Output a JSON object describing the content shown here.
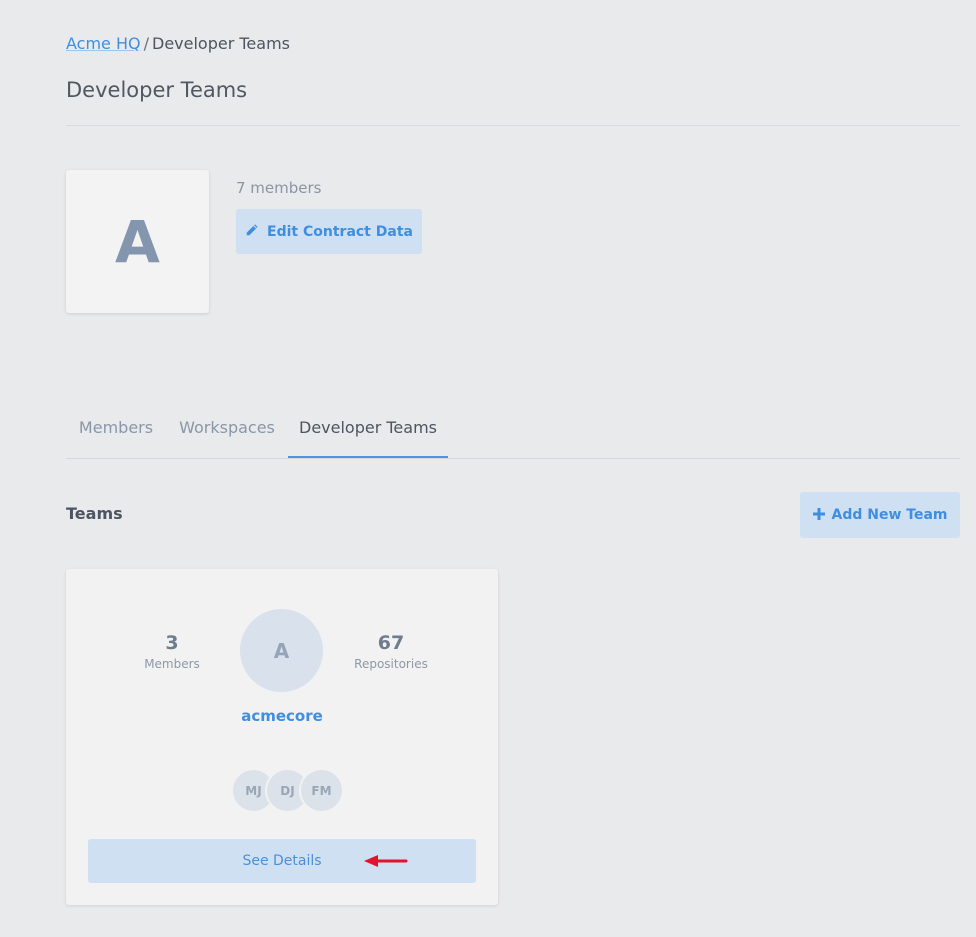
{
  "breadcrumb": {
    "root": "Acme HQ",
    "separator": "/",
    "current": "Developer Teams"
  },
  "page_title": "Developer Teams",
  "org": {
    "avatar_letter": "A",
    "member_count": "7 members",
    "edit_label": "Edit Contract Data"
  },
  "tabs": [
    {
      "label": "Members",
      "active": false
    },
    {
      "label": "Workspaces",
      "active": false
    },
    {
      "label": "Developer Teams",
      "active": true
    }
  ],
  "teams_section": {
    "title": "Teams",
    "add_label": "Add New Team"
  },
  "team_card": {
    "avatar_letter": "A",
    "name": "acmecore",
    "members_count": "3",
    "members_label": "Members",
    "repos_count": "67",
    "repos_label": "Repositories",
    "member_initials": [
      "MJ",
      "DJ",
      "FM"
    ],
    "details_label": "See Details"
  },
  "colors": {
    "accent": "#3f8ee0",
    "button_bg": "#cfe0f2",
    "annotation_arrow": "#e0142c"
  },
  "icons": {
    "edit": "pencil-icon",
    "add": "plus-icon",
    "annotation": "arrow-left-icon"
  }
}
